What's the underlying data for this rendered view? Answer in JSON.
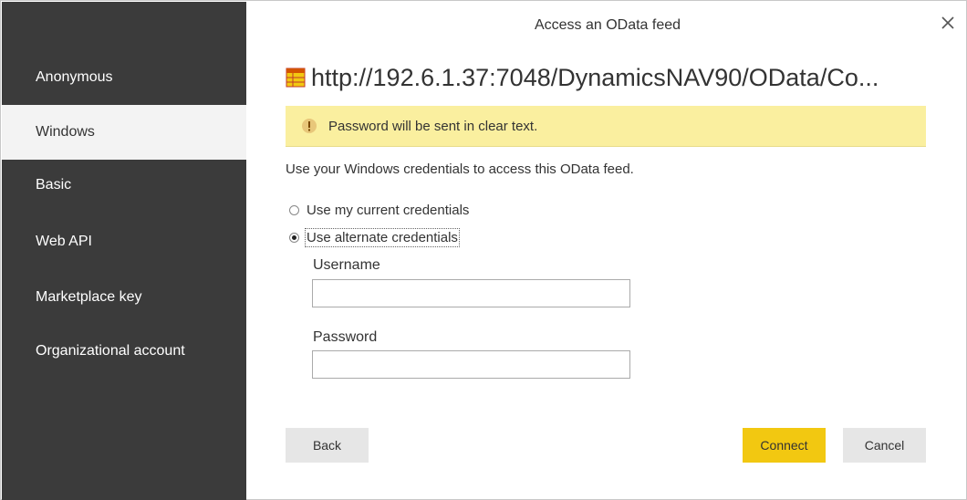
{
  "dialog": {
    "title": "Access an OData feed",
    "url": "http://192.6.1.37:7048/DynamicsNAV90/OData/Co...",
    "close_icon": "close-icon",
    "url_icon": "table-icon"
  },
  "sidebar": {
    "items": [
      {
        "label": "Anonymous"
      },
      {
        "label": "Windows",
        "selected": true
      },
      {
        "label": "Basic"
      },
      {
        "label": "Web API"
      },
      {
        "label": "Marketplace key"
      },
      {
        "label": "Organizational account"
      }
    ]
  },
  "warning": {
    "text": "Password will be sent in clear text.",
    "icon": "warning-icon"
  },
  "main": {
    "description": "Use your Windows credentials to access this OData feed.",
    "radio_current": "Use my current credentials",
    "radio_alternate": "Use alternate credentials",
    "selected_option": "Use alternate credentials",
    "username_label": "Username",
    "username_value": "",
    "password_label": "Password",
    "password_value": ""
  },
  "buttons": {
    "back": "Back",
    "connect": "Connect",
    "cancel": "Cancel"
  },
  "colors": {
    "sidebar_bg": "#3b3b3b",
    "sidebar_selected_bg": "#f3f3f3",
    "warning_bg": "#faef9f",
    "primary_button": "#f2c811",
    "secondary_button": "#e6e6e6"
  }
}
